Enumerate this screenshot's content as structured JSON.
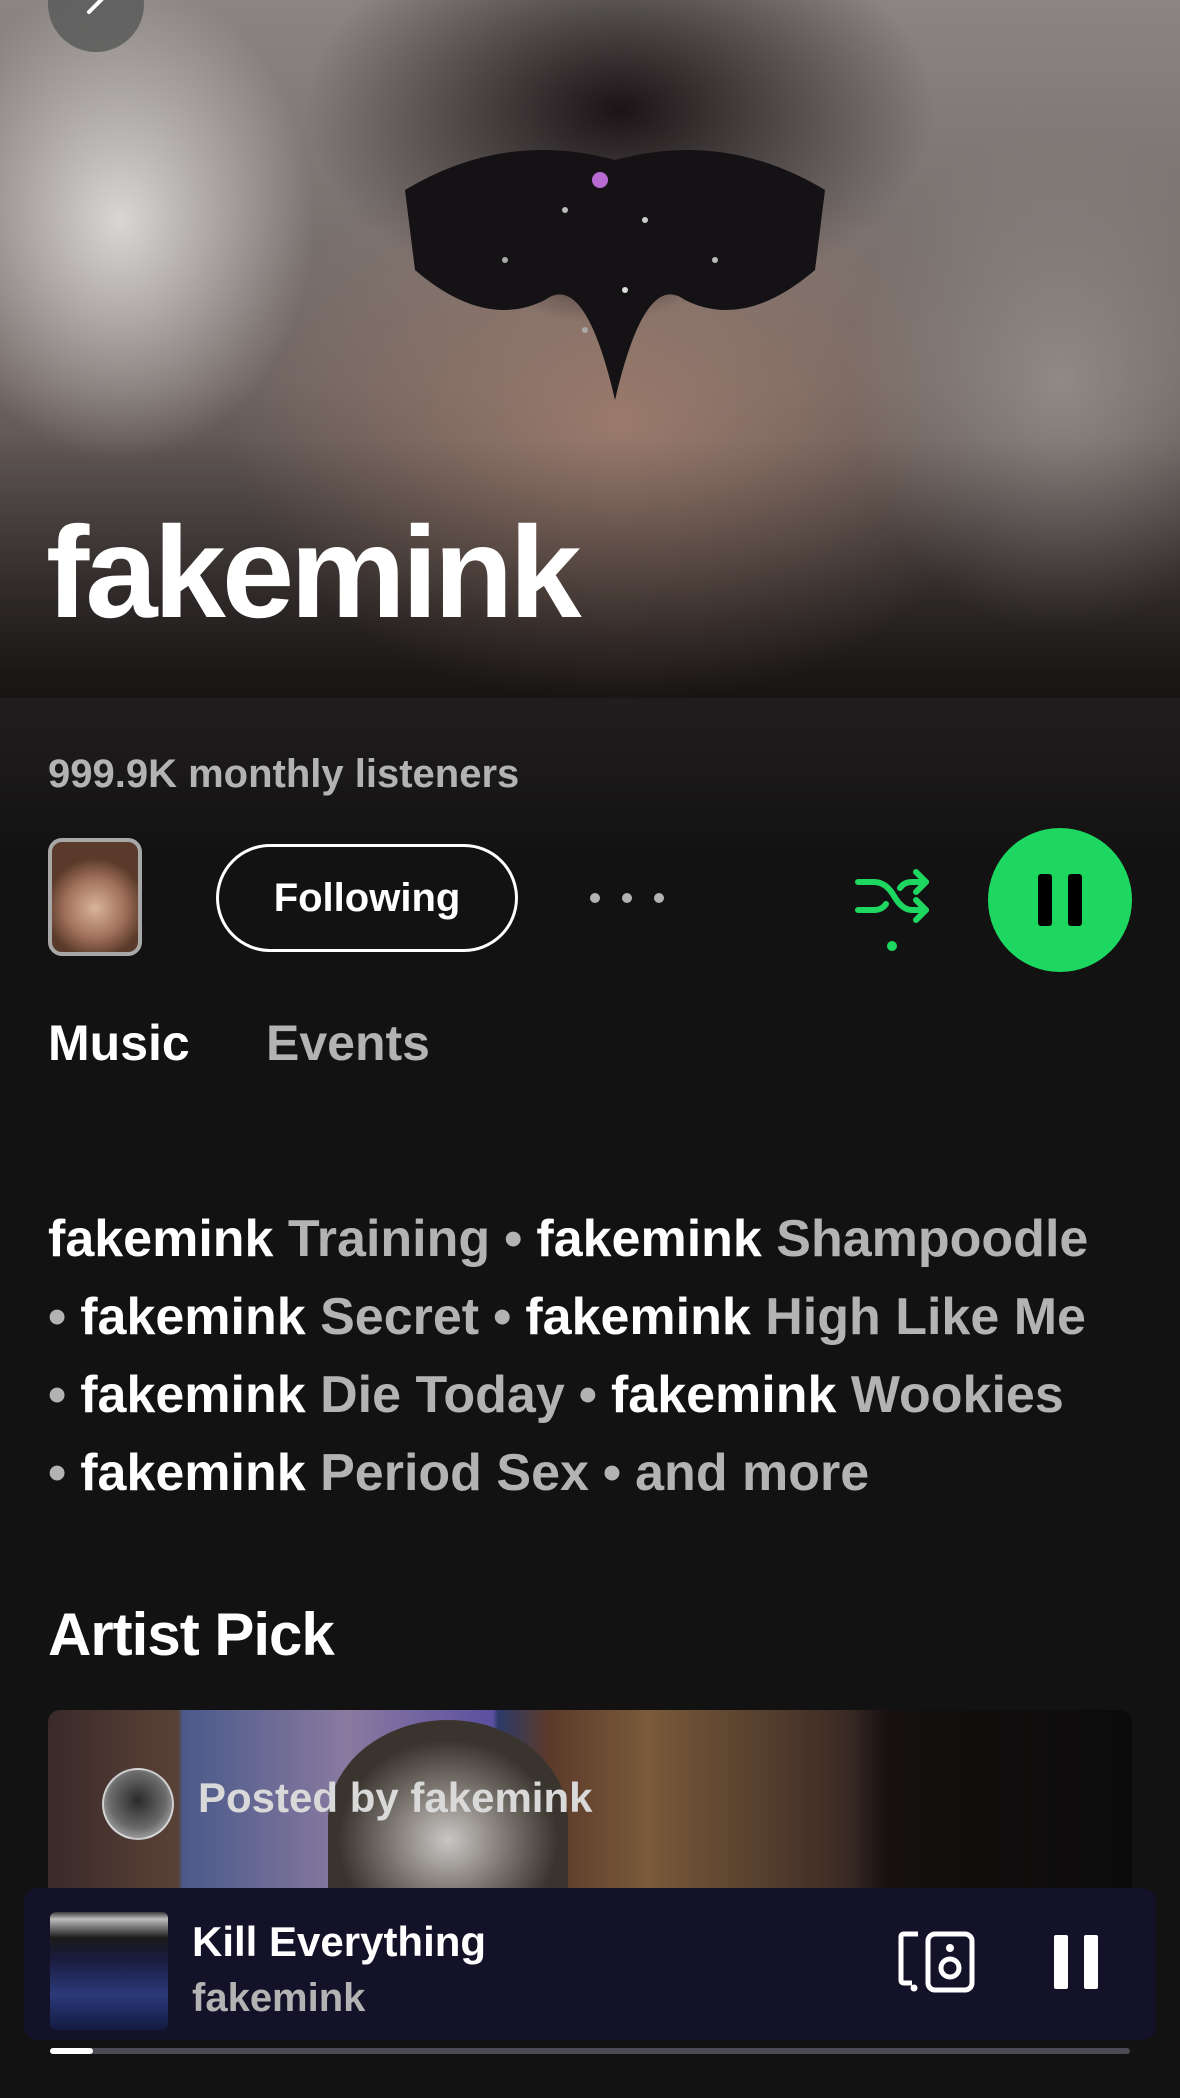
{
  "artist": {
    "name": "fakemink",
    "monthly_listeners": "999.9K monthly listeners"
  },
  "actions": {
    "follow_label": "Following"
  },
  "tabs": [
    {
      "label": "Music",
      "active": true
    },
    {
      "label": "Events",
      "active": false
    }
  ],
  "featuring": {
    "items": [
      {
        "artist": "fakemink",
        "title": "Training"
      },
      {
        "artist": "fakemink",
        "title": "Shampoodle"
      },
      {
        "artist": "fakemink",
        "title": "Secret"
      },
      {
        "artist": "fakemink",
        "title": "High Like Me"
      },
      {
        "artist": "fakemink",
        "title": "Die Today"
      },
      {
        "artist": "fakemink",
        "title": "Wookies"
      },
      {
        "artist": "fakemink",
        "title": "Period Sex"
      }
    ],
    "more_label": "and more"
  },
  "artist_pick": {
    "section_title": "Artist Pick",
    "posted_by": "Posted by fakemink"
  },
  "now_playing": {
    "title": "Kill Everything",
    "artist": "fakemink",
    "progress": 0.04
  },
  "colors": {
    "accent": "#1ed760",
    "background": "#121212",
    "secondary_text": "#b3b3b3",
    "player_bg": "#141229"
  },
  "icons": {
    "back": "chevron-left-icon",
    "more": "more-options-icon",
    "shuffle": "shuffle-icon",
    "play_pause": "pause-icon",
    "device": "connect-device-icon",
    "mini_pause": "pause-icon"
  }
}
